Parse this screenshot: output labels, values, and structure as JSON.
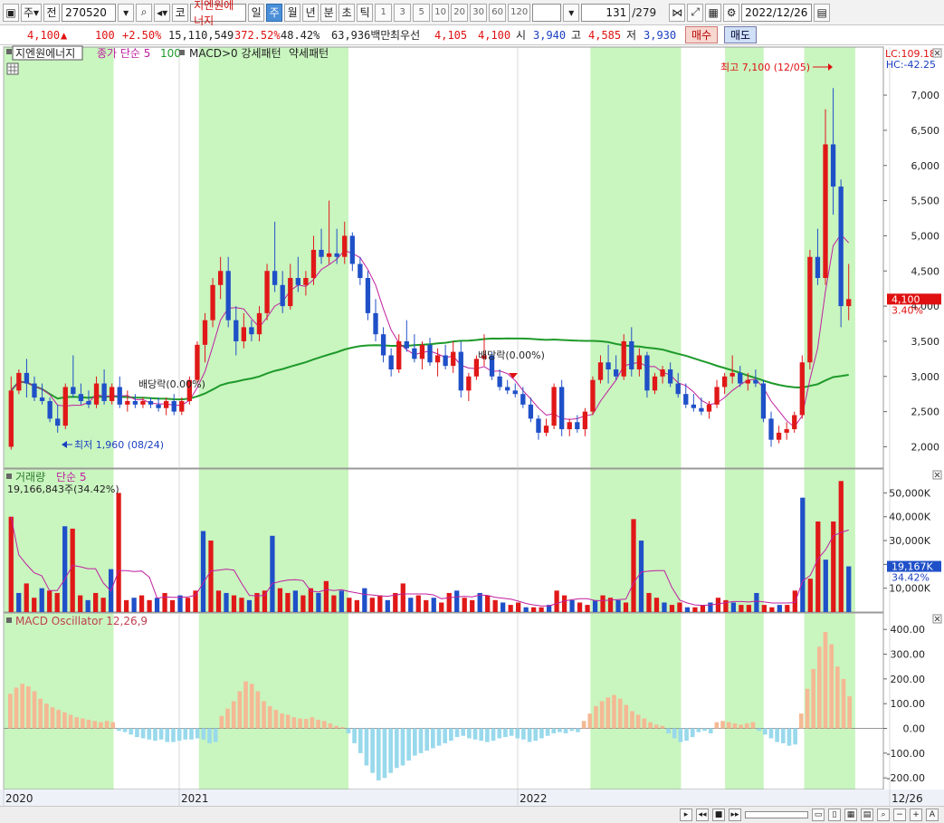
{
  "toolbar": {
    "market": "주",
    "prev_label": "전",
    "code": "270520",
    "type_label": "코",
    "name": "지엔원에너지",
    "periods": [
      "일",
      "주",
      "월",
      "년",
      "분",
      "초",
      "틱"
    ],
    "active_period": "주",
    "intervals": [
      "1",
      "3",
      "5",
      "10",
      "20",
      "30",
      "60",
      "120"
    ],
    "count": "131",
    "total": "/279",
    "date": "2022/12/26"
  },
  "quote": {
    "price": "4,100",
    "change": "100",
    "change_pct": "+2.50%",
    "volume": "15,110,549",
    "volume_ratio": "372.52%",
    "turnover": "48.42%",
    "amount": "63,936백만",
    "best_bid_label": "최우선",
    "best_ask": "4,105",
    "best_bid": "4,100",
    "open_label": "시",
    "open": "3,940",
    "high_label": "고",
    "high": "4,585",
    "low_label": "저",
    "low": "3,930",
    "buy": "매수",
    "sell": "매도"
  },
  "chart_data": {
    "type": "candlestick",
    "price_panel": {
      "legend": [
        "지엔원에너지",
        "종가 단순 5",
        "100",
        "MACD>0 강세패턴",
        "약세패턴"
      ],
      "y_ticks": [
        "7,000",
        "6,500",
        "6,000",
        "5,500",
        "5,000",
        "4,500",
        "4,000",
        "3,500",
        "3,000",
        "2,500",
        "2,000"
      ],
      "ylim": [
        1800,
        7400
      ],
      "lc_label": "LC:109.18",
      "hc_label": "HC:-42.25",
      "current_price": "4,100",
      "current_pct": "3.40%",
      "high_annotation": "최고 7,100 (12/05)",
      "low_annotation": "최저 1,960 (08/24)",
      "dividend_labels": [
        "배당락(0.00%)",
        "배당락(0.00%)"
      ],
      "candles": [
        {
          "o": 2000,
          "h": 3000,
          "l": 1960,
          "c": 2800
        },
        {
          "o": 2800,
          "h": 3100,
          "l": 2750,
          "c": 3050
        },
        {
          "o": 3050,
          "h": 3250,
          "l": 2700,
          "c": 2900
        },
        {
          "o": 2900,
          "h": 3000,
          "l": 2650,
          "c": 2700
        },
        {
          "o": 2700,
          "h": 2900,
          "l": 2600,
          "c": 2650
        },
        {
          "o": 2650,
          "h": 2700,
          "l": 2350,
          "c": 2400
        },
        {
          "o": 2400,
          "h": 2600,
          "l": 2200,
          "c": 2300
        },
        {
          "o": 2300,
          "h": 2900,
          "l": 2250,
          "c": 2850
        },
        {
          "o": 2850,
          "h": 3300,
          "l": 2700,
          "c": 2750
        },
        {
          "o": 2750,
          "h": 2900,
          "l": 2600,
          "c": 2650
        },
        {
          "o": 2650,
          "h": 2800,
          "l": 2550,
          "c": 2600
        },
        {
          "o": 2600,
          "h": 3000,
          "l": 2550,
          "c": 2900
        },
        {
          "o": 2900,
          "h": 3100,
          "l": 2600,
          "c": 2650
        },
        {
          "o": 2650,
          "h": 2900,
          "l": 2600,
          "c": 2850
        },
        {
          "o": 2850,
          "h": 3000,
          "l": 2550,
          "c": 2600
        },
        {
          "o": 2600,
          "h": 2800,
          "l": 2500,
          "c": 2650
        },
        {
          "o": 2650,
          "h": 2750,
          "l": 2550,
          "c": 2600
        },
        {
          "o": 2600,
          "h": 2700,
          "l": 2550,
          "c": 2650
        },
        {
          "o": 2650,
          "h": 2700,
          "l": 2550,
          "c": 2600
        },
        {
          "o": 2600,
          "h": 2700,
          "l": 2500,
          "c": 2550
        },
        {
          "o": 2550,
          "h": 2700,
          "l": 2450,
          "c": 2650
        },
        {
          "o": 2650,
          "h": 2750,
          "l": 2450,
          "c": 2500
        },
        {
          "o": 2500,
          "h": 2700,
          "l": 2450,
          "c": 2650
        },
        {
          "o": 2650,
          "h": 3000,
          "l": 2600,
          "c": 2950
        },
        {
          "o": 2950,
          "h": 3500,
          "l": 2900,
          "c": 3450
        },
        {
          "o": 3450,
          "h": 3900,
          "l": 3200,
          "c": 3800
        },
        {
          "o": 3800,
          "h": 4400,
          "l": 3700,
          "c": 4300
        },
        {
          "o": 4300,
          "h": 4700,
          "l": 4100,
          "c": 4500
        },
        {
          "o": 4500,
          "h": 4700,
          "l": 3700,
          "c": 3800
        },
        {
          "o": 3800,
          "h": 4000,
          "l": 3300,
          "c": 3500
        },
        {
          "o": 3500,
          "h": 3900,
          "l": 3400,
          "c": 3700
        },
        {
          "o": 3700,
          "h": 3800,
          "l": 3500,
          "c": 3600
        },
        {
          "o": 3600,
          "h": 4000,
          "l": 3500,
          "c": 3900
        },
        {
          "o": 3900,
          "h": 4600,
          "l": 3800,
          "c": 4500
        },
        {
          "o": 4500,
          "h": 5200,
          "l": 4200,
          "c": 4300
        },
        {
          "o": 4300,
          "h": 4500,
          "l": 3900,
          "c": 4000
        },
        {
          "o": 4000,
          "h": 4600,
          "l": 3950,
          "c": 4400
        },
        {
          "o": 4400,
          "h": 4700,
          "l": 4200,
          "c": 4300
        },
        {
          "o": 4300,
          "h": 4500,
          "l": 4150,
          "c": 4400
        },
        {
          "o": 4400,
          "h": 5000,
          "l": 4300,
          "c": 4800
        },
        {
          "o": 4800,
          "h": 5100,
          "l": 4600,
          "c": 4700
        },
        {
          "o": 4700,
          "h": 5500,
          "l": 4600,
          "c": 4750
        },
        {
          "o": 4750,
          "h": 5100,
          "l": 4600,
          "c": 4700
        },
        {
          "o": 4700,
          "h": 5200,
          "l": 4600,
          "c": 5000
        },
        {
          "o": 5000,
          "h": 5050,
          "l": 4500,
          "c": 4600
        },
        {
          "o": 4600,
          "h": 4700,
          "l": 4300,
          "c": 4400
        },
        {
          "o": 4400,
          "h": 4500,
          "l": 3800,
          "c": 3900
        },
        {
          "o": 3900,
          "h": 4100,
          "l": 3500,
          "c": 3600
        },
        {
          "o": 3600,
          "h": 3700,
          "l": 3200,
          "c": 3300
        },
        {
          "o": 3300,
          "h": 3400,
          "l": 3000,
          "c": 3100
        },
        {
          "o": 3100,
          "h": 3600,
          "l": 3050,
          "c": 3500
        },
        {
          "o": 3500,
          "h": 3800,
          "l": 3350,
          "c": 3400
        },
        {
          "o": 3400,
          "h": 3600,
          "l": 3200,
          "c": 3250
        },
        {
          "o": 3250,
          "h": 3500,
          "l": 3100,
          "c": 3450
        },
        {
          "o": 3450,
          "h": 3550,
          "l": 3150,
          "c": 3200
        },
        {
          "o": 3200,
          "h": 3400,
          "l": 3000,
          "c": 3300
        },
        {
          "o": 3300,
          "h": 3450,
          "l": 3100,
          "c": 3150
        },
        {
          "o": 3150,
          "h": 3500,
          "l": 3050,
          "c": 3350
        },
        {
          "o": 3350,
          "h": 3500,
          "l": 2700,
          "c": 2800
        },
        {
          "o": 2800,
          "h": 3050,
          "l": 2650,
          "c": 3000
        },
        {
          "o": 3000,
          "h": 3300,
          "l": 2950,
          "c": 3250
        },
        {
          "o": 3250,
          "h": 3600,
          "l": 3150,
          "c": 3300
        },
        {
          "o": 3300,
          "h": 3350,
          "l": 2950,
          "c": 3000
        },
        {
          "o": 3000,
          "h": 3100,
          "l": 2800,
          "c": 2850
        },
        {
          "o": 2850,
          "h": 2950,
          "l": 2750,
          "c": 2800
        },
        {
          "o": 2800,
          "h": 2900,
          "l": 2700,
          "c": 2750
        },
        {
          "o": 2750,
          "h": 2850,
          "l": 2550,
          "c": 2600
        },
        {
          "o": 2600,
          "h": 2700,
          "l": 2350,
          "c": 2400
        },
        {
          "o": 2400,
          "h": 2450,
          "l": 2100,
          "c": 2200
        },
        {
          "o": 2200,
          "h": 2400,
          "l": 2150,
          "c": 2300
        },
        {
          "o": 2300,
          "h": 2900,
          "l": 2250,
          "c": 2850
        },
        {
          "o": 2850,
          "h": 2950,
          "l": 2150,
          "c": 2250
        },
        {
          "o": 2250,
          "h": 2400,
          "l": 2150,
          "c": 2350
        },
        {
          "o": 2350,
          "h": 2450,
          "l": 2200,
          "c": 2250
        },
        {
          "o": 2250,
          "h": 2550,
          "l": 2150,
          "c": 2500
        },
        {
          "o": 2500,
          "h": 3000,
          "l": 2450,
          "c": 2950
        },
        {
          "o": 2950,
          "h": 3300,
          "l": 2900,
          "c": 3200
        },
        {
          "o": 3200,
          "h": 3450,
          "l": 2900,
          "c": 3100
        },
        {
          "o": 3100,
          "h": 3300,
          "l": 2950,
          "c": 3000
        },
        {
          "o": 3000,
          "h": 3600,
          "l": 2950,
          "c": 3500
        },
        {
          "o": 3500,
          "h": 3700,
          "l": 3000,
          "c": 3100
        },
        {
          "o": 3100,
          "h": 3400,
          "l": 3000,
          "c": 3300
        },
        {
          "o": 3300,
          "h": 3350,
          "l": 2700,
          "c": 2800
        },
        {
          "o": 2800,
          "h": 3050,
          "l": 2750,
          "c": 3000
        },
        {
          "o": 3000,
          "h": 3150,
          "l": 2900,
          "c": 3100
        },
        {
          "o": 3100,
          "h": 3200,
          "l": 2850,
          "c": 2900
        },
        {
          "o": 2900,
          "h": 3050,
          "l": 2700,
          "c": 2750
        },
        {
          "o": 2750,
          "h": 2900,
          "l": 2550,
          "c": 2600
        },
        {
          "o": 2600,
          "h": 2750,
          "l": 2500,
          "c": 2550
        },
        {
          "o": 2550,
          "h": 2700,
          "l": 2450,
          "c": 2500
        },
        {
          "o": 2500,
          "h": 2650,
          "l": 2400,
          "c": 2600
        },
        {
          "o": 2600,
          "h": 2950,
          "l": 2550,
          "c": 2850
        },
        {
          "o": 2850,
          "h": 3050,
          "l": 2750,
          "c": 3000
        },
        {
          "o": 3000,
          "h": 3300,
          "l": 2900,
          "c": 3050
        },
        {
          "o": 3050,
          "h": 3150,
          "l": 2850,
          "c": 2900
        },
        {
          "o": 2900,
          "h": 3050,
          "l": 2800,
          "c": 2950
        },
        {
          "o": 2950,
          "h": 3100,
          "l": 2850,
          "c": 2900
        },
        {
          "o": 2900,
          "h": 2950,
          "l": 2350,
          "c": 2400
        },
        {
          "o": 2400,
          "h": 2500,
          "l": 2000,
          "c": 2100
        },
        {
          "o": 2100,
          "h": 2300,
          "l": 2050,
          "c": 2200
        },
        {
          "o": 2200,
          "h": 2350,
          "l": 2100,
          "c": 2250
        },
        {
          "o": 2250,
          "h": 2500,
          "l": 2200,
          "c": 2450
        },
        {
          "o": 2450,
          "h": 3300,
          "l": 2400,
          "c": 3200
        },
        {
          "o": 3200,
          "h": 4800,
          "l": 3100,
          "c": 4700
        },
        {
          "o": 4700,
          "h": 5100,
          "l": 4300,
          "c": 4400
        },
        {
          "o": 4400,
          "h": 6800,
          "l": 4300,
          "c": 6300
        },
        {
          "o": 6300,
          "h": 7100,
          "l": 5300,
          "c": 5700
        },
        {
          "o": 5700,
          "h": 5800,
          "l": 3700,
          "c": 4000
        },
        {
          "o": 4000,
          "h": 4600,
          "l": 3800,
          "c": 4100
        }
      ]
    },
    "volume_panel": {
      "legend": [
        "거래량",
        "단순 5"
      ],
      "current_label": "19,166,843주(34.42%)",
      "y_ticks": [
        "50,000K",
        "40,000K",
        "30,000K",
        "20,000K",
        "10,000K"
      ],
      "ylim": [
        0,
        57000
      ],
      "current_value": "19,167K",
      "current_pct": "34.42%",
      "values": [
        40000,
        8000,
        12000,
        6000,
        10000,
        9000,
        8000,
        36000,
        35000,
        7000,
        5000,
        8000,
        6000,
        18000,
        50000,
        5000,
        6000,
        7000,
        5000,
        6000,
        8000,
        5000,
        7000,
        6000,
        9000,
        34000,
        30000,
        9000,
        8000,
        7000,
        6000,
        5000,
        8000,
        9000,
        32000,
        10000,
        8000,
        9000,
        7000,
        10000,
        8000,
        13000,
        7000,
        9000,
        6000,
        5000,
        10000,
        6000,
        7000,
        5000,
        8000,
        12000,
        6000,
        7000,
        5000,
        6000,
        4000,
        8000,
        9000,
        6000,
        5000,
        8000,
        7000,
        5000,
        4000,
        3000,
        4000,
        2000,
        2000,
        2000,
        3000,
        9000,
        7000,
        5000,
        4000,
        3000,
        5000,
        7000,
        6000,
        5000,
        4000,
        39000,
        30000,
        8000,
        6000,
        4000,
        3000,
        4000,
        2000,
        2000,
        3000,
        4000,
        6000,
        5000,
        4000,
        3000,
        3000,
        8000,
        3000,
        2000,
        3000,
        3000,
        9000,
        48000,
        14000,
        38000,
        22000,
        38000,
        55000,
        19167
      ]
    },
    "macd_panel": {
      "legend": "MACD Oscillator 12,26,9",
      "y_ticks": [
        "400.00",
        "300.00",
        "200.00",
        "100.00",
        "0.00",
        "-100.00",
        "-200.00"
      ],
      "ylim": [
        -225,
        430
      ],
      "values": [
        140,
        165,
        180,
        170,
        150,
        120,
        100,
        85,
        75,
        65,
        55,
        45,
        40,
        35,
        30,
        25,
        30,
        25,
        -10,
        -15,
        -25,
        -35,
        -40,
        -45,
        -50,
        -45,
        -55,
        -55,
        -50,
        -45,
        -45,
        -40,
        -45,
        -60,
        -55,
        50,
        80,
        110,
        150,
        190,
        180,
        150,
        110,
        90,
        75,
        60,
        55,
        45,
        40,
        38,
        45,
        35,
        30,
        20,
        10,
        5,
        -20,
        -60,
        -100,
        -150,
        -180,
        -210,
        -200,
        -180,
        -160,
        -150,
        -130,
        -110,
        -100,
        -90,
        -80,
        -70,
        -60,
        -50,
        -35,
        -30,
        -40,
        -45,
        -50,
        -55,
        -50,
        -40,
        -35,
        -30,
        -40,
        -45,
        -55,
        -50,
        -40,
        -30,
        -20,
        -15,
        -20,
        -10,
        -15,
        30,
        60,
        90,
        110,
        125,
        135,
        120,
        95,
        70,
        55,
        40,
        25,
        15,
        10,
        -20,
        -40,
        -55,
        -50,
        -35,
        -15,
        -10,
        -20,
        25,
        30,
        25,
        20,
        15,
        20,
        25,
        -10,
        -25,
        -40,
        -55,
        -60,
        -70,
        -65,
        60,
        160,
        240,
        330,
        390,
        340,
        250,
        200,
        130
      ]
    },
    "x_labels": [
      "2020",
      "2021",
      "2022",
      "12/26"
    ]
  },
  "colors": {
    "up": "#e01818",
    "down": "#1f50c8",
    "ma5": "#c01fa0",
    "ma100": "#1e9a2a",
    "bull_zone": "#c9f5bf",
    "macd_pos": "#f4b994",
    "macd_neg": "#99d9ec"
  }
}
